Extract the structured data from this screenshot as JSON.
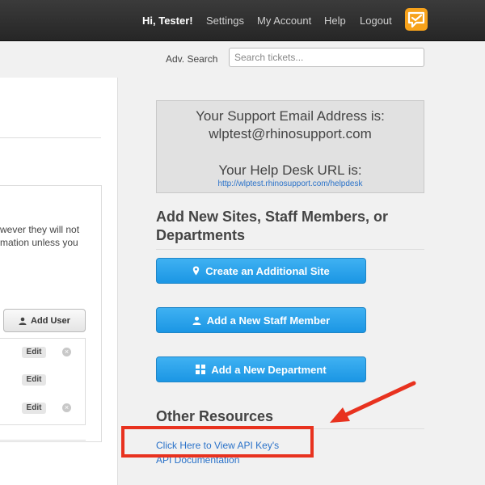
{
  "topbar": {
    "greeting": "Hi, Tester!",
    "nav": [
      "Settings",
      "My Account",
      "Help",
      "Logout"
    ],
    "logo_icon": "rhino-logo-icon",
    "accent_color": "#f7a21b"
  },
  "search": {
    "label": "Adv. Search",
    "placeholder": "Search tickets..."
  },
  "left": {
    "notice_line1": "wever they will not",
    "notice_line2": "mation unless you",
    "add_user_label": "Add User",
    "edit_label": "Edit"
  },
  "info": {
    "email_heading": "Your Support Email Address is:",
    "email": "wlptest@rhinosupport.com",
    "url_heading": "Your Help Desk URL is:",
    "url": "http://wlptest.rhinosupport.com/helpdesk"
  },
  "add_section": {
    "title_line1": "Add New Sites, Staff Members, or",
    "title_line2": "Departments",
    "buttons": [
      "Create an Additional Site",
      "Add a New Staff Member",
      "Add a New Department"
    ],
    "button_color": "#1b96e4"
  },
  "resources": {
    "title": "Other Resources",
    "links": [
      "Click Here to View API Key's",
      "API Documentation"
    ]
  },
  "annotation": {
    "color": "#e8321f"
  }
}
